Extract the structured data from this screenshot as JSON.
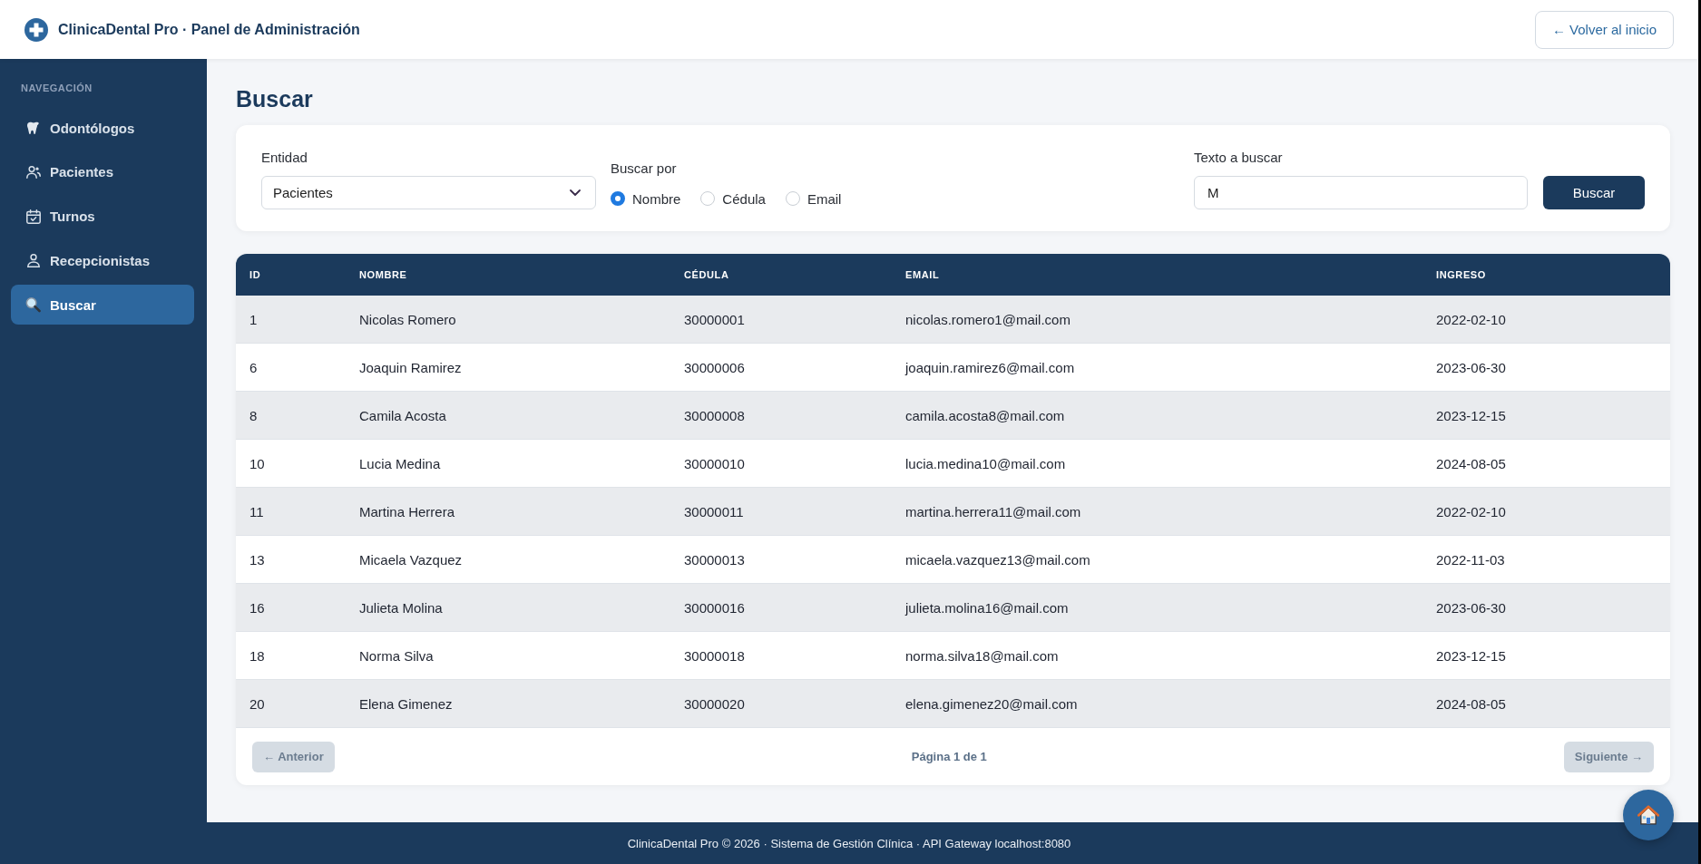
{
  "header": {
    "title": "ClinicaDental Pro · Panel de Administración",
    "back_button": "← Volver al inicio"
  },
  "sidebar": {
    "section_title": "NAVEGACIÓN",
    "items": [
      {
        "label": "Odontólogos",
        "kind": "tooth",
        "selected": false
      },
      {
        "label": "Pacientes",
        "kind": "users",
        "selected": false
      },
      {
        "label": "Turnos",
        "kind": "calendar",
        "selected": false
      },
      {
        "label": "Recepcionistas",
        "kind": "user",
        "selected": false
      },
      {
        "label": "Buscar",
        "kind": "search",
        "selected": true
      }
    ]
  },
  "page_title": "Buscar",
  "search_form": {
    "entity": {
      "label": "Entidad",
      "value": "Pacientes"
    },
    "search_by": {
      "label": "Buscar por",
      "options": [
        {
          "label": "Nombre",
          "selected": true
        },
        {
          "label": "Cédula",
          "selected": false
        },
        {
          "label": "Email",
          "selected": false
        }
      ]
    },
    "query": {
      "label": "Texto a buscar",
      "value": "M"
    },
    "submit_button": "Buscar"
  },
  "table": {
    "columns": [
      "ID",
      "NOMBRE",
      "CÉDULA",
      "EMAIL",
      "INGRESO"
    ],
    "rows": [
      [
        "1",
        "Nicolas Romero",
        "30000001",
        "nicolas.romero1@mail.com",
        "2022-02-10"
      ],
      [
        "6",
        "Joaquin Ramirez",
        "30000006",
        "joaquin.ramirez6@mail.com",
        "2023-06-30"
      ],
      [
        "8",
        "Camila Acosta",
        "30000008",
        "camila.acosta8@mail.com",
        "2023-12-15"
      ],
      [
        "10",
        "Lucia Medina",
        "30000010",
        "lucia.medina10@mail.com",
        "2024-08-05"
      ],
      [
        "11",
        "Martina Herrera",
        "30000011",
        "martina.herrera11@mail.com",
        "2022-02-10"
      ],
      [
        "13",
        "Micaela Vazquez",
        "30000013",
        "micaela.vazquez13@mail.com",
        "2022-11-03"
      ],
      [
        "16",
        "Julieta Molina",
        "30000016",
        "julieta.molina16@mail.com",
        "2023-06-30"
      ],
      [
        "18",
        "Norma Silva",
        "30000018",
        "norma.silva18@mail.com",
        "2023-12-15"
      ],
      [
        "20",
        "Elena Gimenez",
        "30000020",
        "elena.gimenez20@mail.com",
        "2024-08-05"
      ]
    ]
  },
  "pagination": {
    "previous": {
      "label": "← Anterior",
      "disabled": true
    },
    "page_info": "Página 1 de 1",
    "next": {
      "label": "Siguiente →",
      "disabled": true
    }
  },
  "footer": "ClinicaDental Pro © 2026 · Sistema de Gestión Clínica · API Gateway localhost:8080"
}
